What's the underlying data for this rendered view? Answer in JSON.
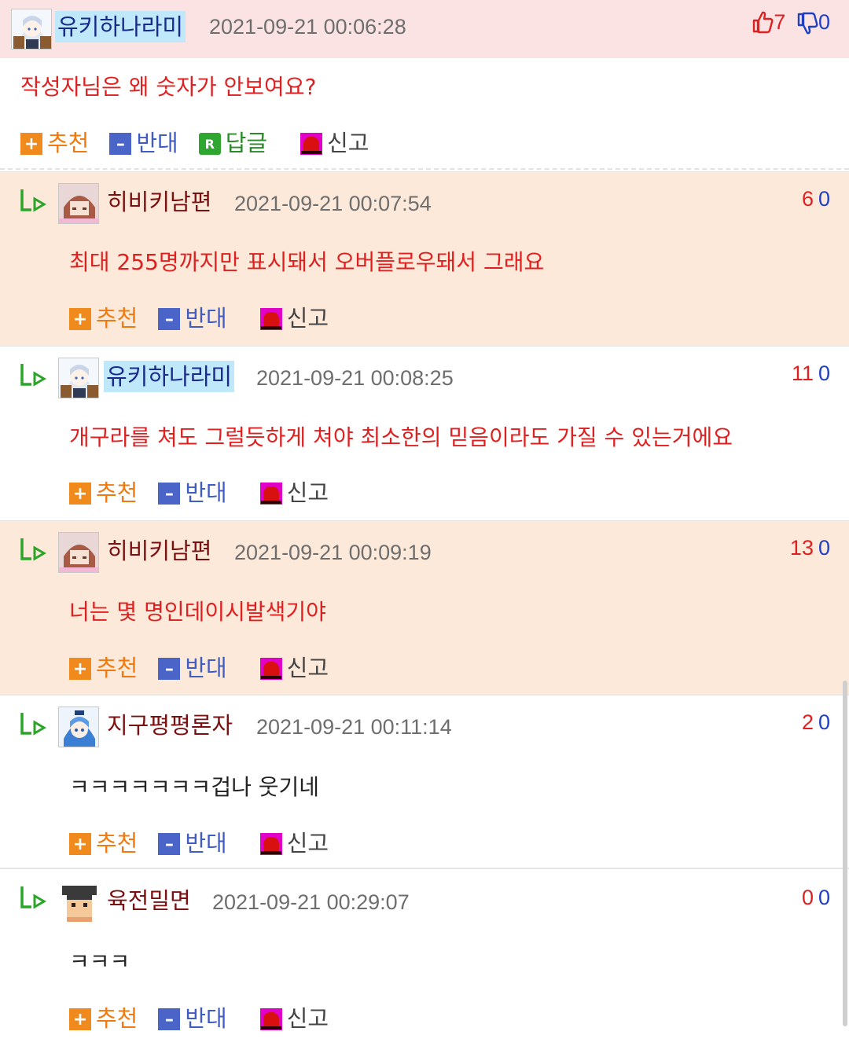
{
  "colors": {
    "header_bg": "#fbe3e3",
    "alt_reply_bg": "#fde9d9",
    "comment_text_red": "#e02020",
    "upvote_red": "#e02020",
    "downvote_blue": "#1f3fc4",
    "nickname_highlight": "#bfe9fb"
  },
  "actions": {
    "recommend_label": "추천",
    "oppose_label": "반대",
    "reply_label": "답글",
    "report_label": "신고"
  },
  "main_comment": {
    "nickname": "유키하나라미",
    "date": "2021-09-21 00:06:28",
    "up": "7",
    "down": "0",
    "text": "작성자님은 왜 숫자가 안보여요?",
    "avatar": "anime-girl-avatar"
  },
  "replies": [
    {
      "nickname": "히비키남편",
      "date": "2021-09-21 00:07:54",
      "up": "6",
      "down": "0",
      "text": "최대 255명까지만 표시돼서 오버플로우돼서 그래요",
      "avatar": "brown-hair-girl-avatar"
    },
    {
      "nickname": "유키하나라미",
      "date": "2021-09-21 00:08:25",
      "up": "11",
      "down": "0",
      "text": "개구라를 쳐도 그럴듯하게 쳐야 최소한의 믿음이라도 가질 수 있는거에요",
      "avatar": "anime-girl-avatar"
    },
    {
      "nickname": "히비키남편",
      "date": "2021-09-21 00:09:19",
      "up": "13",
      "down": "0",
      "text": "너는 몇 명인데이시발색기야",
      "avatar": "brown-hair-girl-avatar"
    },
    {
      "nickname": "지구평평론자",
      "date": "2021-09-21 00:11:14",
      "up": "2",
      "down": "0",
      "text": "ㅋㅋㅋㅋㅋㅋㅋ겁나 웃기네",
      "avatar": "blue-hair-girl-avatar"
    },
    {
      "nickname": "육전밀면",
      "date": "2021-09-21 00:29:07",
      "up": "0",
      "down": "0",
      "text": "ㅋㅋㅋ",
      "avatar": "pixel-boy-avatar"
    }
  ]
}
